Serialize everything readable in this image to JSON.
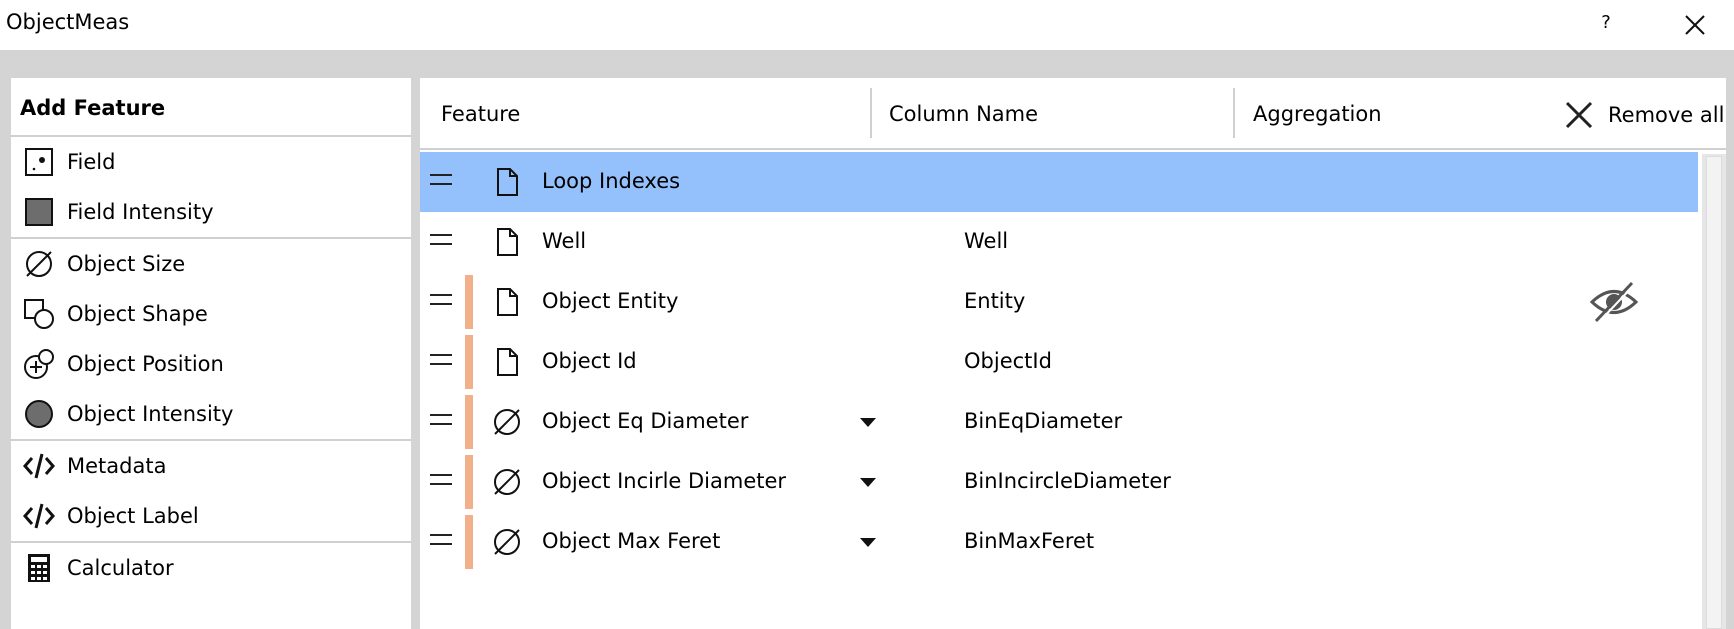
{
  "window": {
    "title": "ObjectMeas",
    "help_label": "?"
  },
  "left_panel": {
    "heading": "Add Feature",
    "groups": [
      [
        {
          "label": "Field",
          "icon": "field-dot-icon"
        },
        {
          "label": "Field Intensity",
          "icon": "field-intensity-square-icon"
        }
      ],
      [
        {
          "label": "Object Size",
          "icon": "diameter-icon"
        },
        {
          "label": "Object Shape",
          "icon": "shape-icon"
        },
        {
          "label": "Object Position",
          "icon": "position-icon"
        },
        {
          "label": "Object Intensity",
          "icon": "intensity-circle-icon"
        }
      ],
      [
        {
          "label": "Metadata",
          "icon": "code-icon"
        },
        {
          "label": "Object Label",
          "icon": "code-icon"
        }
      ],
      [
        {
          "label": "Calculator",
          "icon": "calculator-icon"
        }
      ]
    ]
  },
  "table": {
    "columns": {
      "feature": "Feature",
      "column_name": "Column Name",
      "aggregation": "Aggregation"
    },
    "remove_all": "Remove all",
    "rows": [
      {
        "name": "Loop Indexes",
        "column_name": "",
        "icon": "document-icon",
        "selected": true,
        "object": false,
        "dropdown": false,
        "hidden": false
      },
      {
        "name": "Well",
        "column_name": "Well",
        "icon": "document-icon",
        "selected": false,
        "object": false,
        "dropdown": false,
        "hidden": false
      },
      {
        "name": "Object Entity",
        "column_name": "Entity",
        "icon": "document-icon",
        "selected": false,
        "object": true,
        "dropdown": false,
        "hidden": true
      },
      {
        "name": "Object Id",
        "column_name": "ObjectId",
        "icon": "document-icon",
        "selected": false,
        "object": true,
        "dropdown": false,
        "hidden": false
      },
      {
        "name": "Object Eq Diameter",
        "column_name": "BinEqDiameter",
        "icon": "diameter-icon",
        "selected": false,
        "object": true,
        "dropdown": true,
        "hidden": false
      },
      {
        "name": "Object Incirle Diameter",
        "column_name": "BinIncircleDiameter",
        "icon": "diameter-icon",
        "selected": false,
        "object": true,
        "dropdown": true,
        "hidden": false
      },
      {
        "name": "Object Max Feret",
        "column_name": "BinMaxFeret",
        "icon": "diameter-icon",
        "selected": false,
        "object": true,
        "dropdown": true,
        "hidden": false
      }
    ]
  },
  "colors": {
    "selected_row": "#94c1fc",
    "object_marker": "#f2b08a",
    "frame": "#d4d4d4"
  }
}
